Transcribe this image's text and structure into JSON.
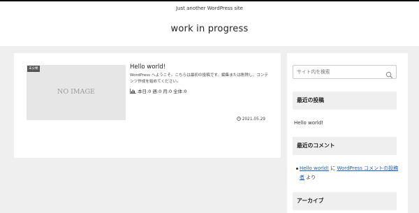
{
  "header": {
    "tagline": "Just another WordPress site",
    "site_title": "work in progress"
  },
  "post": {
    "category": "未分類",
    "no_image_text": "NO IMAGE",
    "title": "Hello world!",
    "excerpt": "WordPress へようこそ。こちらは最初の投稿です。編集または削除し、コンテンツ作成を始めてください。",
    "stats": "本日:0 週:0 月:0 全体:0",
    "date": "2021.05.29"
  },
  "sidebar": {
    "search_placeholder": "サイト内を検索",
    "recent_posts_heading": "最近の投稿",
    "recent_posts": [
      "Hello world!"
    ],
    "recent_comments_heading": "最近のコメント",
    "comment": {
      "post_link": "Hello world!",
      "on_text": " に ",
      "author_link": "WordPress コメントの投稿者",
      "by_text": " より"
    },
    "archives_heading": "アーカイブ"
  },
  "colors": {
    "page_bg": "#efefef",
    "link": "#1a5fc7",
    "badge_bg": "#555555"
  },
  "icons": {
    "search": "search-icon",
    "stats": "bar-chart-icon",
    "date": "clock-icon"
  }
}
